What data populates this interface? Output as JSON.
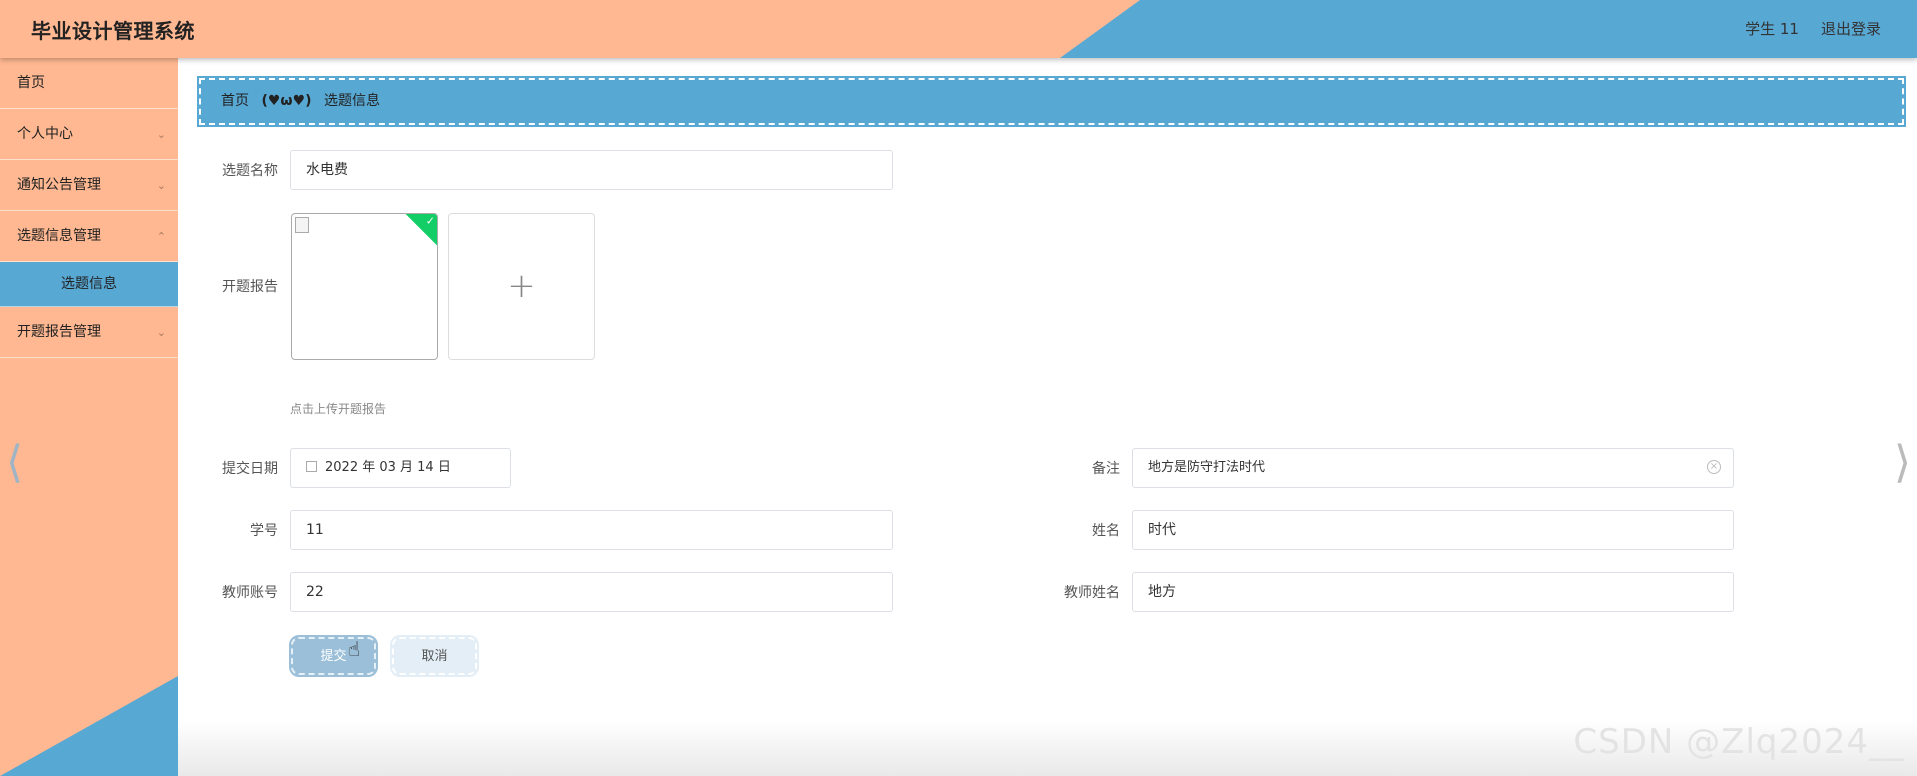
{
  "header": {
    "app_title": "毕业设计管理系统",
    "user_label": "学生 11",
    "logout_label": "退出登录"
  },
  "sidebar": {
    "items": [
      {
        "label": "首页"
      },
      {
        "label": "个人中心"
      },
      {
        "label": "通知公告管理"
      },
      {
        "label": "选题信息管理"
      },
      {
        "label": "选题信息"
      },
      {
        "label": "开题报告管理"
      }
    ]
  },
  "breadcrumb": {
    "home": "首页",
    "separator": "(♥ω♥)",
    "current": "选题信息"
  },
  "form": {
    "topic_name": {
      "label": "选题名称",
      "value": "水电费"
    },
    "proposal_report": {
      "label": "开题报告",
      "tip": "点击上传开题报告"
    },
    "submit_date": {
      "label": "提交日期",
      "value": "2022 年 03 月 14 日"
    },
    "remark": {
      "label": "备注",
      "value": "地方是防守打法时代"
    },
    "student_id": {
      "label": "学号",
      "value": "11"
    },
    "student_name": {
      "label": "姓名",
      "value": "时代"
    },
    "teacher_account": {
      "label": "教师账号",
      "value": "22"
    },
    "teacher_name": {
      "label": "教师姓名",
      "value": "地方"
    }
  },
  "buttons": {
    "submit": "提交",
    "cancel": "取消"
  },
  "icons": {
    "chevron": "chevron-down-icon",
    "plus": "plus-icon",
    "check": "check-icon",
    "calendar": "calendar-icon",
    "clear": "clear-icon",
    "cursor": "hand-cursor-icon"
  },
  "watermark": "CSDN @Zlq2024__",
  "colors": {
    "peach": "#ffb891",
    "blue": "#58a8d4",
    "success": "#13ce66"
  }
}
